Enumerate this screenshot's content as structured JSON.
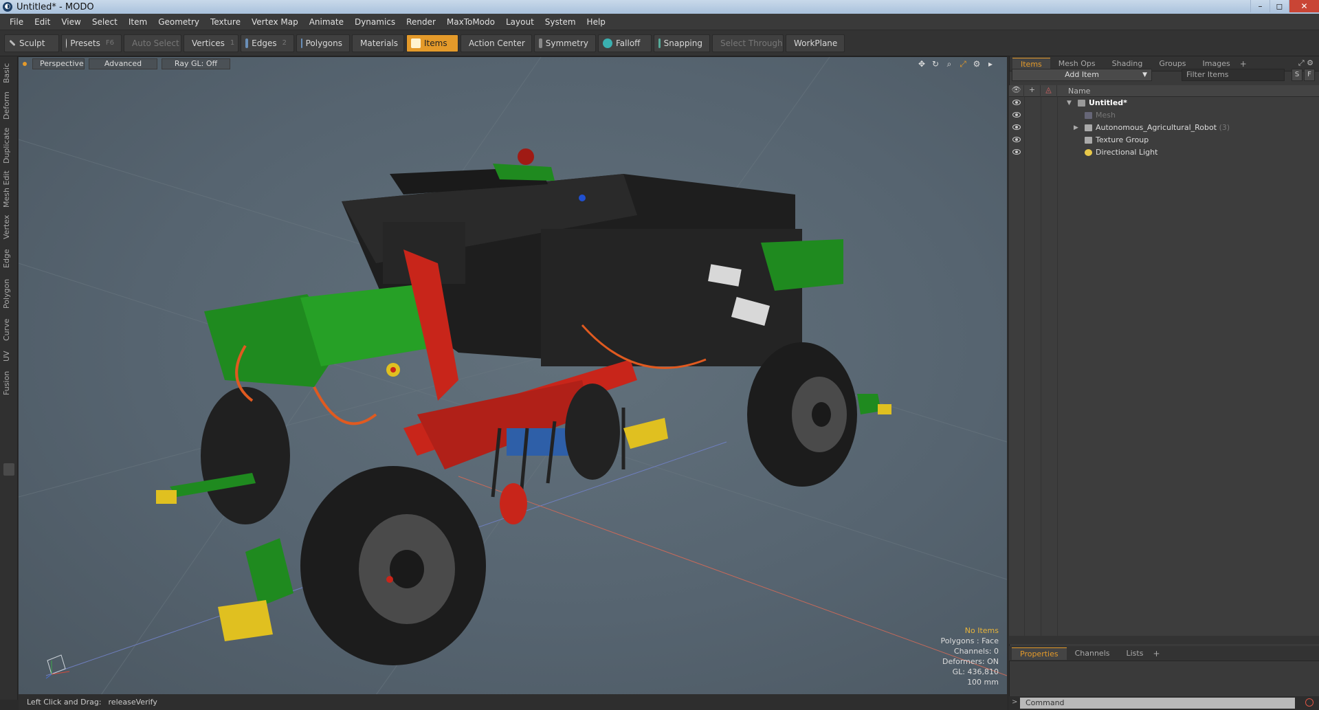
{
  "window": {
    "title": "Untitled* - MODO",
    "controls": [
      "–",
      "◻",
      "✕"
    ]
  },
  "menu": [
    "File",
    "Edit",
    "View",
    "Select",
    "Item",
    "Geometry",
    "Texture",
    "Vertex Map",
    "Animate",
    "Dynamics",
    "Render",
    "MaxToModo",
    "Layout",
    "System",
    "Help"
  ],
  "toolbar": {
    "sculpt": "Sculpt",
    "presets": "Presets",
    "presets_key": "F6",
    "auto_select": "Auto Select",
    "vertices": "Vertices",
    "vertices_key": "1",
    "edges": "Edges",
    "edges_key": "2",
    "polygons": "Polygons",
    "materials": "Materials",
    "items": "Items",
    "action_center": "Action Center",
    "symmetry": "Symmetry",
    "falloff": "Falloff",
    "snapping": "Snapping",
    "select_through": "Select Through",
    "workplane": "WorkPlane"
  },
  "left_tabs": [
    "Basic",
    "Deform",
    "Duplicate",
    "Mesh Edit",
    "Vertex",
    "Edge",
    "Polygon",
    "Curve",
    "UV",
    "Fusion"
  ],
  "viewport": {
    "view": "Perspective",
    "shading": "Advanced",
    "raygl": "Ray GL: Off",
    "icons": [
      "move-view-icon",
      "rotate-view-icon",
      "zoom-view-icon",
      "maximize-icon",
      "settings-icon",
      "expand-icon"
    ],
    "hud": {
      "no_items": "No Items",
      "polygons": "Polygons : Face",
      "channels": "Channels: 0",
      "deformers": "Deformers: ON",
      "gl": "GL: 436,810",
      "scale": "100 mm"
    }
  },
  "status": {
    "hint": "Left Click and Drag:",
    "action": "releaseVerify"
  },
  "panel": {
    "tabs": [
      "Items",
      "Mesh Ops",
      "Shading",
      "Groups",
      "Images"
    ],
    "add_item": "Add Item",
    "filter_placeholder": "Filter Items",
    "btn_s": "S",
    "btn_f": "F",
    "col_name": "Name",
    "rows": [
      {
        "label": "Untitled*",
        "count": ""
      },
      {
        "label": "Mesh",
        "count": ""
      },
      {
        "label": "Autonomous_Agricultural_Robot",
        "count": "(3)"
      },
      {
        "label": "Texture Group",
        "count": ""
      },
      {
        "label": "Directional Light",
        "count": ""
      }
    ],
    "bottom_tabs": [
      "Properties",
      "Channels",
      "Lists"
    ],
    "command_placeholder": "Command"
  },
  "colors": {
    "accent": "#e49a2a",
    "viewport_bg": "#566470",
    "robot_green": "#1f8a1f",
    "robot_red": "#c8251a",
    "robot_black": "#1e1e1e",
    "robot_yellow": "#e0c020"
  }
}
